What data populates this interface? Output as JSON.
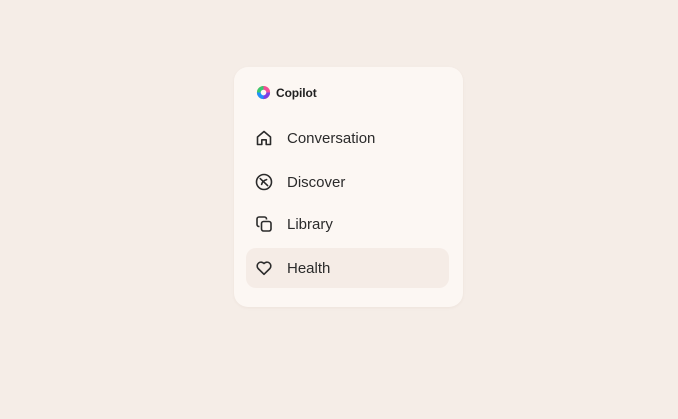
{
  "app": {
    "name": "Copilot"
  },
  "nav": {
    "items": [
      {
        "label": "Conversation",
        "icon": "home-icon",
        "active": false
      },
      {
        "label": "Discover",
        "icon": "compass-icon",
        "active": false
      },
      {
        "label": "Library",
        "icon": "library-icon",
        "active": false
      },
      {
        "label": "Health",
        "icon": "heart-icon",
        "active": true
      }
    ]
  },
  "colors": {
    "background": "#f5ede7",
    "panel": "#fcf7f3",
    "active_item": "#f5ece6",
    "text": "#2b2b2b",
    "logo": [
      "#1f8fff",
      "#7b3fe4",
      "#f24e9b",
      "#ff9f1c",
      "#37c871"
    ]
  }
}
